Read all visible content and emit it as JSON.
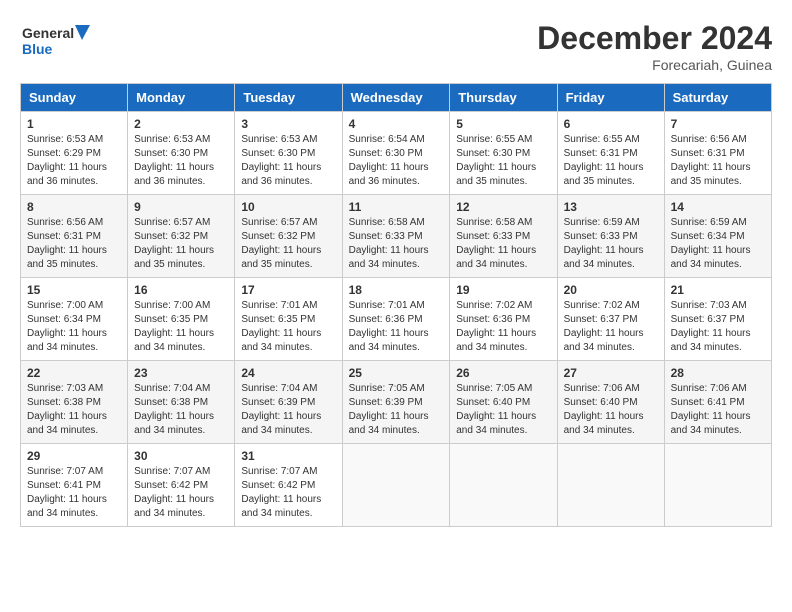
{
  "header": {
    "logo_line1": "General",
    "logo_line2": "Blue",
    "month_title": "December 2024",
    "location": "Forecariah, Guinea"
  },
  "weekdays": [
    "Sunday",
    "Monday",
    "Tuesday",
    "Wednesday",
    "Thursday",
    "Friday",
    "Saturday"
  ],
  "weeks": [
    [
      {
        "day": "1",
        "info": "Sunrise: 6:53 AM\nSunset: 6:29 PM\nDaylight: 11 hours\nand 36 minutes."
      },
      {
        "day": "2",
        "info": "Sunrise: 6:53 AM\nSunset: 6:30 PM\nDaylight: 11 hours\nand 36 minutes."
      },
      {
        "day": "3",
        "info": "Sunrise: 6:53 AM\nSunset: 6:30 PM\nDaylight: 11 hours\nand 36 minutes."
      },
      {
        "day": "4",
        "info": "Sunrise: 6:54 AM\nSunset: 6:30 PM\nDaylight: 11 hours\nand 36 minutes."
      },
      {
        "day": "5",
        "info": "Sunrise: 6:55 AM\nSunset: 6:30 PM\nDaylight: 11 hours\nand 35 minutes."
      },
      {
        "day": "6",
        "info": "Sunrise: 6:55 AM\nSunset: 6:31 PM\nDaylight: 11 hours\nand 35 minutes."
      },
      {
        "day": "7",
        "info": "Sunrise: 6:56 AM\nSunset: 6:31 PM\nDaylight: 11 hours\nand 35 minutes."
      }
    ],
    [
      {
        "day": "8",
        "info": "Sunrise: 6:56 AM\nSunset: 6:31 PM\nDaylight: 11 hours\nand 35 minutes."
      },
      {
        "day": "9",
        "info": "Sunrise: 6:57 AM\nSunset: 6:32 PM\nDaylight: 11 hours\nand 35 minutes."
      },
      {
        "day": "10",
        "info": "Sunrise: 6:57 AM\nSunset: 6:32 PM\nDaylight: 11 hours\nand 35 minutes."
      },
      {
        "day": "11",
        "info": "Sunrise: 6:58 AM\nSunset: 6:33 PM\nDaylight: 11 hours\nand 34 minutes."
      },
      {
        "day": "12",
        "info": "Sunrise: 6:58 AM\nSunset: 6:33 PM\nDaylight: 11 hours\nand 34 minutes."
      },
      {
        "day": "13",
        "info": "Sunrise: 6:59 AM\nSunset: 6:33 PM\nDaylight: 11 hours\nand 34 minutes."
      },
      {
        "day": "14",
        "info": "Sunrise: 6:59 AM\nSunset: 6:34 PM\nDaylight: 11 hours\nand 34 minutes."
      }
    ],
    [
      {
        "day": "15",
        "info": "Sunrise: 7:00 AM\nSunset: 6:34 PM\nDaylight: 11 hours\nand 34 minutes."
      },
      {
        "day": "16",
        "info": "Sunrise: 7:00 AM\nSunset: 6:35 PM\nDaylight: 11 hours\nand 34 minutes."
      },
      {
        "day": "17",
        "info": "Sunrise: 7:01 AM\nSunset: 6:35 PM\nDaylight: 11 hours\nand 34 minutes."
      },
      {
        "day": "18",
        "info": "Sunrise: 7:01 AM\nSunset: 6:36 PM\nDaylight: 11 hours\nand 34 minutes."
      },
      {
        "day": "19",
        "info": "Sunrise: 7:02 AM\nSunset: 6:36 PM\nDaylight: 11 hours\nand 34 minutes."
      },
      {
        "day": "20",
        "info": "Sunrise: 7:02 AM\nSunset: 6:37 PM\nDaylight: 11 hours\nand 34 minutes."
      },
      {
        "day": "21",
        "info": "Sunrise: 7:03 AM\nSunset: 6:37 PM\nDaylight: 11 hours\nand 34 minutes."
      }
    ],
    [
      {
        "day": "22",
        "info": "Sunrise: 7:03 AM\nSunset: 6:38 PM\nDaylight: 11 hours\nand 34 minutes."
      },
      {
        "day": "23",
        "info": "Sunrise: 7:04 AM\nSunset: 6:38 PM\nDaylight: 11 hours\nand 34 minutes."
      },
      {
        "day": "24",
        "info": "Sunrise: 7:04 AM\nSunset: 6:39 PM\nDaylight: 11 hours\nand 34 minutes."
      },
      {
        "day": "25",
        "info": "Sunrise: 7:05 AM\nSunset: 6:39 PM\nDaylight: 11 hours\nand 34 minutes."
      },
      {
        "day": "26",
        "info": "Sunrise: 7:05 AM\nSunset: 6:40 PM\nDaylight: 11 hours\nand 34 minutes."
      },
      {
        "day": "27",
        "info": "Sunrise: 7:06 AM\nSunset: 6:40 PM\nDaylight: 11 hours\nand 34 minutes."
      },
      {
        "day": "28",
        "info": "Sunrise: 7:06 AM\nSunset: 6:41 PM\nDaylight: 11 hours\nand 34 minutes."
      }
    ],
    [
      {
        "day": "29",
        "info": "Sunrise: 7:07 AM\nSunset: 6:41 PM\nDaylight: 11 hours\nand 34 minutes."
      },
      {
        "day": "30",
        "info": "Sunrise: 7:07 AM\nSunset: 6:42 PM\nDaylight: 11 hours\nand 34 minutes."
      },
      {
        "day": "31",
        "info": "Sunrise: 7:07 AM\nSunset: 6:42 PM\nDaylight: 11 hours\nand 34 minutes."
      },
      {
        "day": "",
        "info": ""
      },
      {
        "day": "",
        "info": ""
      },
      {
        "day": "",
        "info": ""
      },
      {
        "day": "",
        "info": ""
      }
    ]
  ]
}
